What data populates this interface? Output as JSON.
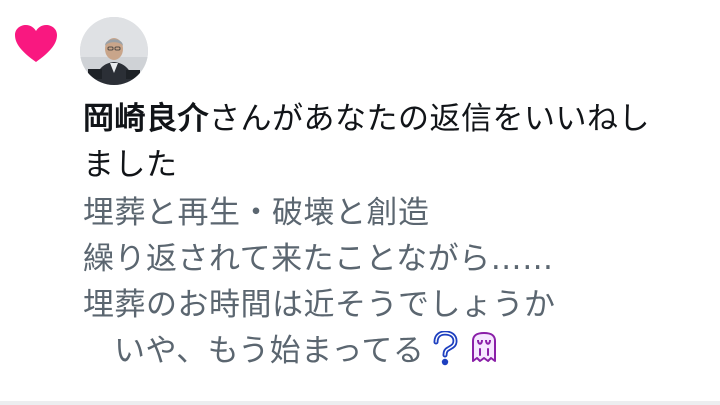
{
  "notification": {
    "type_icon": "heart-icon",
    "accent_color": "#f91880",
    "avatar_icon": "user-avatar",
    "user_name": "岡崎良介",
    "action_text_line1": "さんがあなたの返信をいいねし",
    "action_text_line2": "ました"
  },
  "reply": {
    "lines": [
      "埋葬と再生・破壊と創造",
      "繰り返されて来たことながら……",
      "埋葬のお時間は近そうでしょうか",
      "いや、もう始まってる"
    ],
    "emojis": [
      "question-mark-emoji",
      "ghost-emoji"
    ],
    "text_color": "#5b6670"
  }
}
